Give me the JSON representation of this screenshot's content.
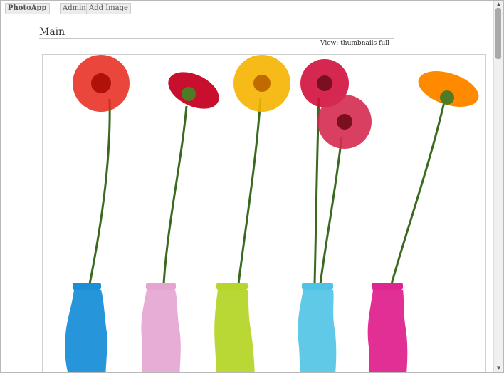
{
  "nav": {
    "brand": "PhotoApp",
    "admin": "Admin",
    "add_image": "Add Image"
  },
  "page": {
    "title": "Main"
  },
  "view": {
    "label": "View:",
    "thumbnails": "thumbnails",
    "full": "full"
  },
  "image": {
    "vase_colors": [
      "#1a8fd8",
      "#e6a4d2",
      "#b5d62b",
      "#4fc3e6",
      "#e0248f"
    ],
    "flower_colors": [
      "#e8261a",
      "#c8102e",
      "#f5b400",
      "#d0103c",
      "#ff8a00"
    ]
  },
  "scrollbar": {
    "up": "▲",
    "down": "▼"
  }
}
